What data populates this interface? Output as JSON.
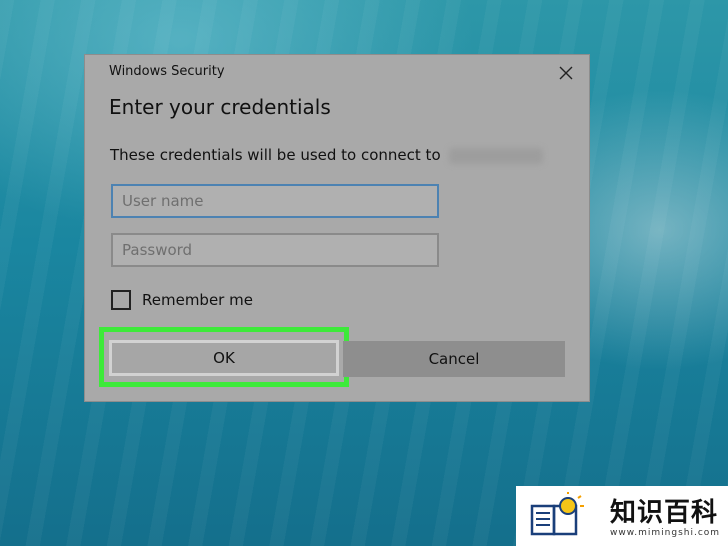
{
  "dialog": {
    "title": "Windows Security",
    "heading": "Enter your credentials",
    "description": "These credentials will be used to connect to",
    "username_placeholder": "User name",
    "username_value": "",
    "password_placeholder": "Password",
    "password_value": "",
    "remember_label": "Remember me",
    "remember_checked": false,
    "ok_label": "OK",
    "cancel_label": "Cancel",
    "highlight_color": "#3dea3a",
    "background_color": "#a9a9a9"
  },
  "watermark": {
    "brand_cn": "知识百科",
    "url": "www.mimingshi.com"
  }
}
